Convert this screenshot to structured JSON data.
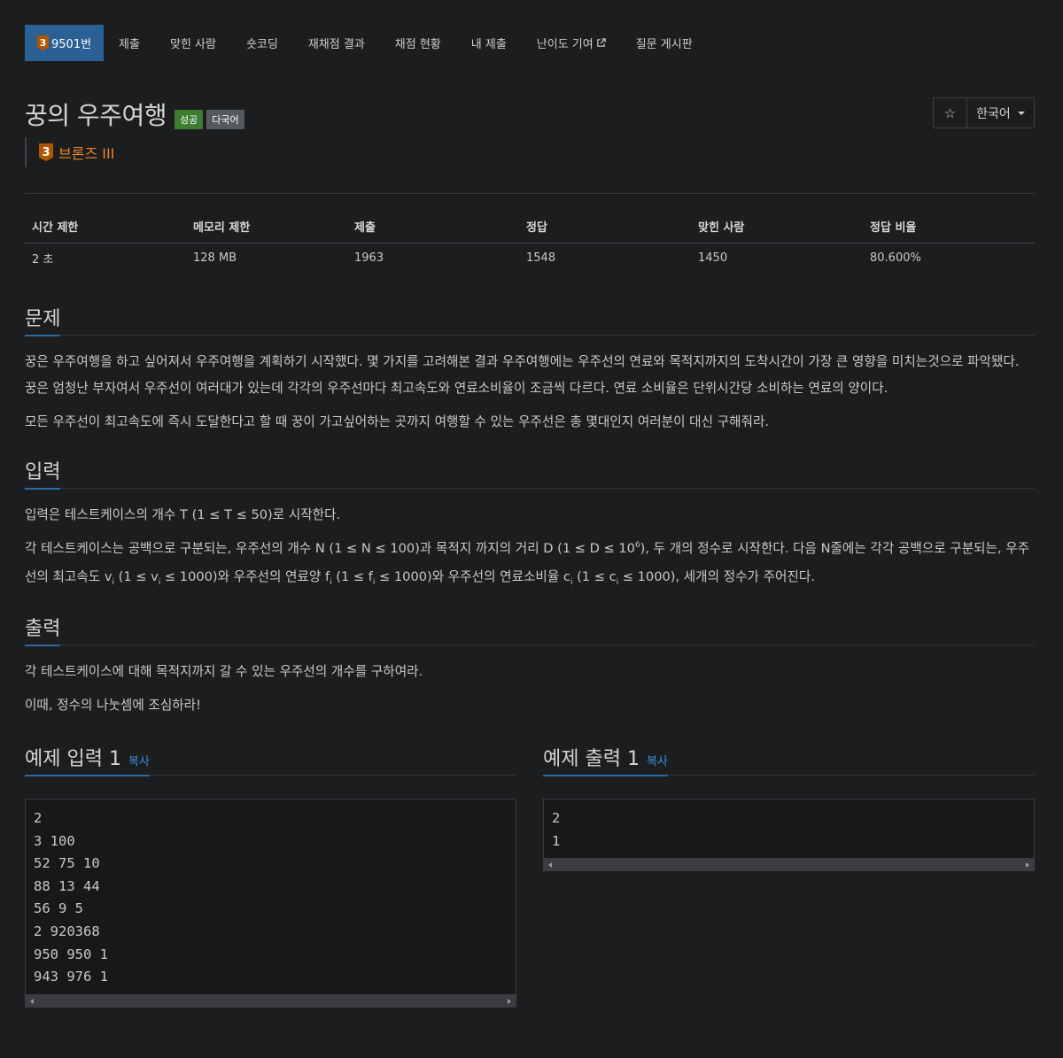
{
  "nav": {
    "problem_tab": {
      "tier_digit": "3",
      "label": "9501번"
    },
    "tabs": [
      "제출",
      "맞힌 사람",
      "숏코딩",
      "재채점 결과",
      "채점 현황",
      "내 제출"
    ],
    "difficulty": "난이도 기여",
    "board": "질문 게시판"
  },
  "problem": {
    "title": "꿍의 우주여행",
    "badge_success": "성공",
    "badge_multi": "다국어",
    "star": "☆",
    "language": "한국어",
    "tier_digit": "3",
    "tier": "브론즈 III"
  },
  "info": {
    "headers": [
      "시간 제한",
      "메모리 제한",
      "제출",
      "정답",
      "맞힌 사람",
      "정답 비율"
    ],
    "values": [
      "2 초",
      "128 MB",
      "1963",
      "1548",
      "1450",
      "80.600%"
    ]
  },
  "sections": {
    "problem_title": "문제",
    "problem_p1": "꿍은 우주여행을 하고 싶어져서 우주여행을 계획하기 시작했다. 몇 가지를 고려해본 결과 우주여행에는 우주선의 연료와 목적지까지의 도착시간이 가장 큰 영향을 미치는것으로 파악됐다. 꿍은 엄청난 부자여서 우주선이 여러대가 있는데 각각의 우주선마다 최고속도와 연료소비율이 조금씩 다르다. 연료 소비율은 단위시간당 소비하는 연료의 양이다.",
    "problem_p2": "모든 우주선이 최고속도에 즉시 도달한다고 할 때 꿍이 가고싶어하는 곳까지 여행할 수 있는 우주선은 총 몇대인지 여러분이 대신 구해줘라.",
    "input_title": "입력",
    "input_p1": "입력은 테스트케이스의 개수 T (1 ≤ T ≤ 50)로 시작한다.",
    "input_p2_a": "각 테스트케이스는 공백으로 구분되는, 우주선의 개수 N (1 ≤ N ≤ 100)과 목적지 까지의 거리 D (1 ≤ D ≤ 10",
    "input_p2_sup": "6",
    "input_p2_b": "), 두 개의 정수로 시작한다. 다음 N줄에는 각각 공백으로 구분되는, 우주선의 최고속도 v",
    "input_p2_c": " (1 ≤ v",
    "input_p2_d": " ≤ 1000)와 우주선의 연료양 f",
    "input_p2_e": " (1 ≤ f",
    "input_p2_f": " ≤ 1000)와 우주선의 연료소비율 c",
    "input_p2_g": " (1 ≤ c",
    "input_p2_h": " ≤ 1000), 세개의 정수가 주어진다.",
    "sub_i": "i",
    "output_title": "출력",
    "output_p1": "각 테스트케이스에 대해 목적지까지 갈 수 있는 우주선의 개수를 구하여라.",
    "output_p2": "이때, 정수의 나눗셈에 조심하라!"
  },
  "samples": {
    "input_title": "예제 입력 1",
    "output_title": "예제 출력 1",
    "copy": "복사",
    "input_lines": [
      "2",
      "3 100",
      "52 75 10",
      "88 13 44",
      "56 9 5",
      "2 920368",
      "950 950 1",
      "943 976 1"
    ],
    "output_lines": [
      "2",
      "1"
    ]
  },
  "colors": {
    "accent": "#2a6093",
    "tier_bronze": "#ad5600",
    "tier_text": "#e8862a",
    "success": "#3e7c32"
  }
}
